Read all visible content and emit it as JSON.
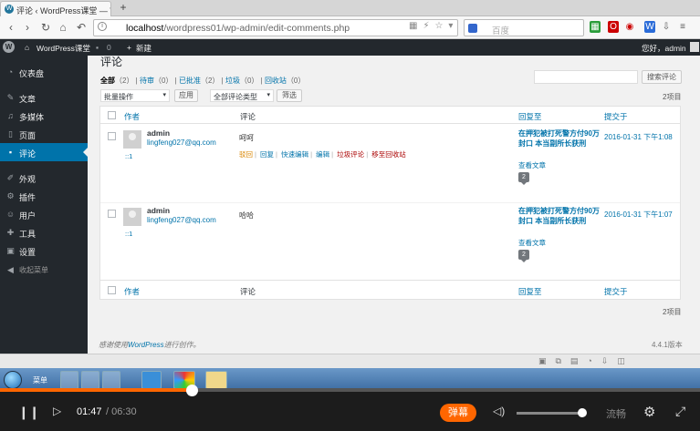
{
  "browser": {
    "tab_title": "评论 ‹ WordPress课堂 — V",
    "new_tab": "+",
    "url_host": "localhost",
    "url_path": "/wordpress01/wp-admin/edit-comments.php",
    "search_placeholder": "百度"
  },
  "adminbar": {
    "site_name": "WordPress课堂",
    "comments_count": "0",
    "new_label": "新建",
    "greeting": "您好，admin"
  },
  "sidebar": {
    "items": [
      {
        "label": "仪表盘",
        "icon": "dashboard-icon"
      },
      {
        "label": "文章",
        "icon": "pin-icon"
      },
      {
        "label": "多媒体",
        "icon": "media-icon"
      },
      {
        "label": "页面",
        "icon": "page-icon"
      },
      {
        "label": "评论",
        "icon": "comment-icon",
        "active": true
      },
      {
        "label": "外观",
        "icon": "brush-icon"
      },
      {
        "label": "插件",
        "icon": "plugin-icon"
      },
      {
        "label": "用户",
        "icon": "user-icon"
      },
      {
        "label": "工具",
        "icon": "wrench-icon"
      },
      {
        "label": "设置",
        "icon": "settings-icon"
      },
      {
        "label": "收起菜单",
        "icon": "collapse-icon"
      }
    ]
  },
  "page": {
    "title": "评论",
    "filters": {
      "all": "全部",
      "all_count": "（2）",
      "pending": "待审",
      "pending_count": "（0）",
      "approved": "已批准",
      "approved_count": "（2）",
      "spam": "垃圾",
      "spam_count": "（0）",
      "trash": "回收站",
      "trash_count": "（0）"
    },
    "search_button": "搜索评论",
    "bulk_action": "批量操作",
    "apply": "应用",
    "type_filter": "全部评论类型",
    "filter_button": "筛选",
    "items_count": "2项目"
  },
  "table": {
    "columns": {
      "author": "作者",
      "comment": "评论",
      "response": "回复至",
      "submitted": "提交于"
    },
    "rows": [
      {
        "author": "admin",
        "email": "lingfeng027@qq.com",
        "ip": "::1",
        "text": "呵呵",
        "actions": [
          "驳回",
          "回复",
          "快速编辑",
          "编辑",
          "垃圾评论",
          "移至回收站"
        ],
        "response_title": "在押犯被打死警方付90万封口 本当副所长获刑",
        "view_post": "查看文章",
        "bubble": "2",
        "date": "2016-01-31 下午1:08"
      },
      {
        "author": "admin",
        "email": "lingfeng027@qq.com",
        "ip": "::1",
        "text": "哈哈",
        "response_title": "在押犯被打死警方付90万封口 本当副所长获刑",
        "view_post": "查看文章",
        "bubble": "2",
        "date": "2016-01-31 下午1:07"
      }
    ]
  },
  "footer": {
    "thanks_prefix": "感谢使用",
    "wordpress_link": "WordPress",
    "thanks_suffix": "进行创作。",
    "version": "4.4.1版本"
  },
  "taskbar": {
    "start_label": "菜单"
  },
  "player": {
    "current_time": "01:47",
    "total_time": "/ 06:30",
    "danmu": "弹幕",
    "quality": "流畅",
    "progress": 0.274
  }
}
